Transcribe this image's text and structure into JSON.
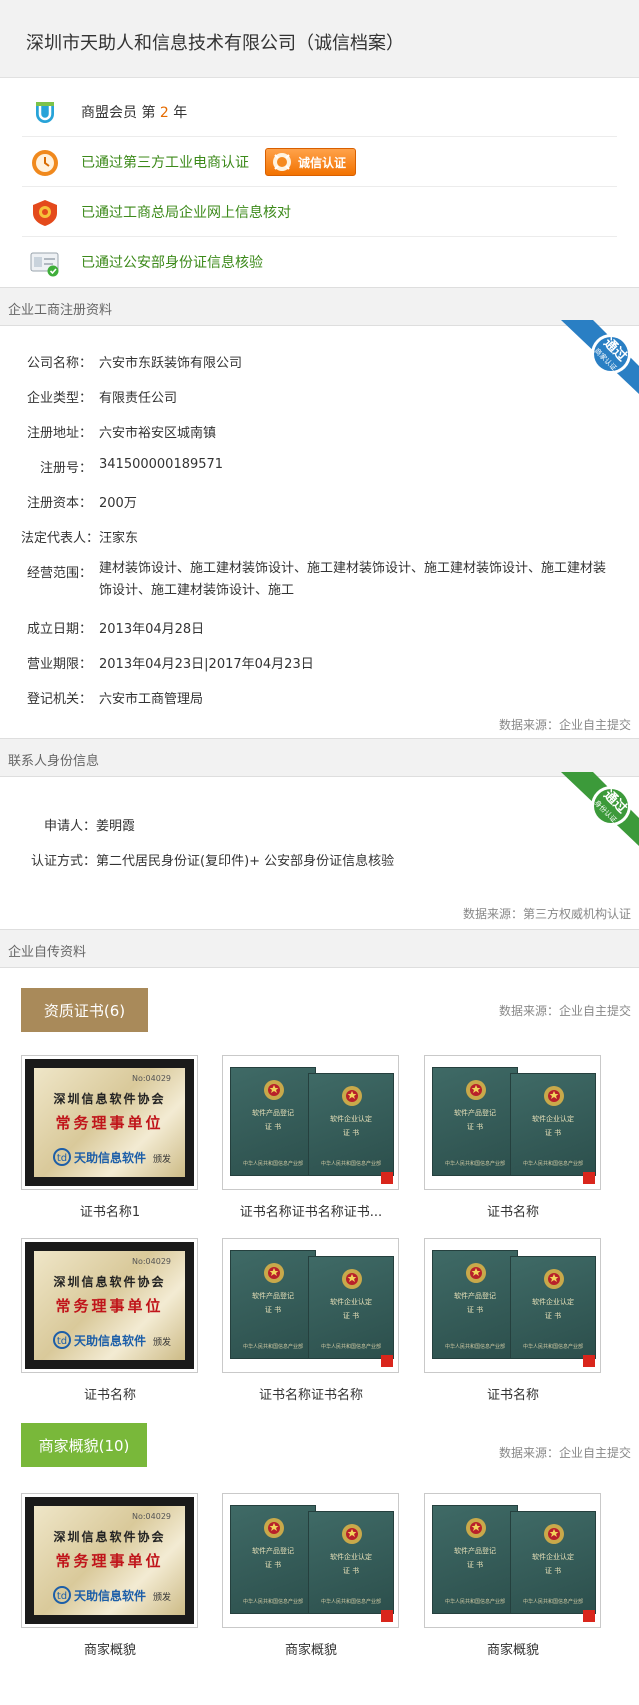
{
  "header": {
    "title": "深圳市天助人和信息技术有限公司（诚信档案）"
  },
  "verifications": [
    {
      "icon": "member-shield-icon",
      "prefix": "商盟会员 第 ",
      "number": "2",
      "suffix": " 年"
    },
    {
      "icon": "clock-medal-icon",
      "text": "已通过第三方工业电商认证",
      "badge": "诚信认证"
    },
    {
      "icon": "red-seal-icon",
      "text": "已通过工商总局企业网上信息核对"
    },
    {
      "icon": "id-card-icon",
      "text": "已通过公安部身份证信息核验"
    }
  ],
  "registration": {
    "section_title": "企业工商注册资料",
    "ribbon_line1": "通过",
    "ribbon_line2": "商家认证",
    "rows": [
      {
        "label": "公司名称：",
        "value": "六安市东跃装饰有限公司"
      },
      {
        "label": "企业类型：",
        "value": "有限责任公司"
      },
      {
        "label": "注册地址：",
        "value": "六安市裕安区城南镇"
      },
      {
        "label": "注册号：",
        "value": "341500000189571"
      },
      {
        "label": "注册资本：",
        "value": "200万"
      },
      {
        "label": "法定代表人：",
        "value": "汪家东"
      },
      {
        "label": "经营范围：",
        "value": "建材装饰设计、施工建材装饰设计、施工建材装饰设计、施工建材装饰设计、施工建材装饰设计、施工建材装饰设计、施工"
      },
      {
        "label": "成立日期：",
        "value": "2013年04月28日"
      },
      {
        "label": "营业期限：",
        "value": "2013年04月23日|2017年04月23日"
      },
      {
        "label": "登记机关：",
        "value": "六安市工商管理局"
      }
    ],
    "source": "数据来源：企业自主提交"
  },
  "contact": {
    "section_title": "联系人身份信息",
    "ribbon_line1": "通过",
    "ribbon_line2": "身份认证",
    "rows": [
      {
        "label": "申请人：",
        "value": "姜明霞"
      },
      {
        "label": "认证方式：",
        "value": "第二代居民身份证(复印件)+ 公安部身份证信息核验"
      }
    ],
    "source": "数据来源：第三方权威机构认证"
  },
  "self": {
    "section_title": "企业自传资料",
    "certs": {
      "tab": "资质证书(6)",
      "source": "数据来源：企业自主提交",
      "items": [
        {
          "kind": "plaque",
          "caption": "证书名称1"
        },
        {
          "kind": "book",
          "caption": "证书名称证书名称证书..."
        },
        {
          "kind": "book",
          "caption": "证书名称"
        },
        {
          "kind": "plaque",
          "caption": "证书名称"
        },
        {
          "kind": "book",
          "caption": "证书名称证书名称"
        },
        {
          "kind": "book",
          "caption": "证书名称"
        }
      ]
    },
    "gallery": {
      "tab": "商家概貌(10)",
      "source": "数据来源：企业自主提交",
      "items": [
        {
          "kind": "plaque",
          "caption": "商家概貌"
        },
        {
          "kind": "book",
          "caption": "商家概貌"
        },
        {
          "kind": "book",
          "caption": "商家概貌"
        }
      ]
    }
  },
  "plaque_text": {
    "no": "No:04029",
    "line1": "深圳信息软件协会",
    "line2": "常务理事单位",
    "logo": "天助信息软件",
    "issued": "颁发"
  },
  "book_text": {
    "title": "软件产品登记",
    "title2": "软件企业认定",
    "cert": "证 书",
    "issuer": "中华人民共和国信息产业部"
  },
  "colors": {
    "green_text": "#3c8a1a",
    "orange_number": "#e56b00",
    "brown_tab": "#a98a5a",
    "green_tab": "#79b83a",
    "blue_ribbon": "#2a7fc4",
    "green_ribbon": "#3c9a3a"
  }
}
